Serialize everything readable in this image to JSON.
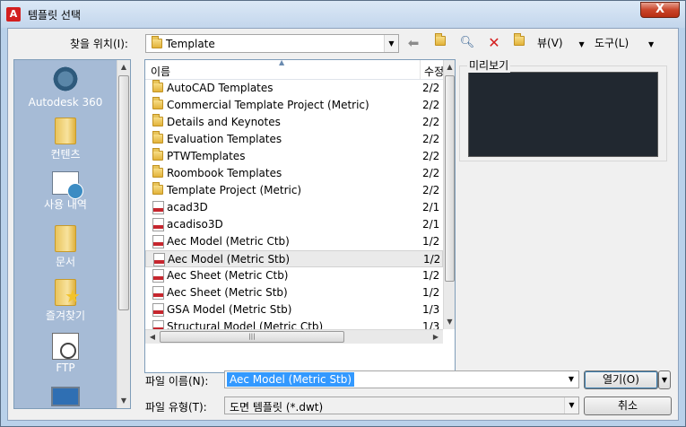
{
  "window": {
    "title": "템플릿 선택",
    "close_label": "X"
  },
  "toolbar": {
    "look_in_label": "찾을 위치(I):",
    "look_in_value": "Template",
    "views_label": "뷰(V)",
    "tools_label": "도구(L)"
  },
  "places": [
    {
      "label": "Autodesk 360",
      "icon": "autodesk-360-icon"
    },
    {
      "label": "컨텐츠",
      "icon": "folder-icon"
    },
    {
      "label": "사용 내역",
      "icon": "history-icon"
    },
    {
      "label": "문서",
      "icon": "folder-icon"
    },
    {
      "label": "즐겨찾기",
      "icon": "favorites-icon"
    },
    {
      "label": "FTP",
      "icon": "ftp-icon"
    }
  ],
  "file_list": {
    "columns": [
      "이름",
      "수정"
    ],
    "rows": [
      {
        "name": "AutoCAD Templates",
        "date": "2/2",
        "type": "folder"
      },
      {
        "name": "Commercial Template Project (Metric)",
        "date": "2/2",
        "type": "folder"
      },
      {
        "name": "Details and Keynotes",
        "date": "2/2",
        "type": "folder"
      },
      {
        "name": "Evaluation Templates",
        "date": "2/2",
        "type": "folder"
      },
      {
        "name": "PTWTemplates",
        "date": "2/2",
        "type": "folder"
      },
      {
        "name": "Roombook Templates",
        "date": "2/2",
        "type": "folder"
      },
      {
        "name": "Template Project (Metric)",
        "date": "2/2",
        "type": "folder"
      },
      {
        "name": "acad3D",
        "date": "2/1",
        "type": "dwt"
      },
      {
        "name": "acadiso3D",
        "date": "2/1",
        "type": "dwt"
      },
      {
        "name": "Aec Model (Metric Ctb)",
        "date": "1/2",
        "type": "dwt"
      },
      {
        "name": "Aec Model (Metric Stb)",
        "date": "1/2",
        "type": "dwt"
      },
      {
        "name": "Aec Sheet (Metric Ctb)",
        "date": "1/2",
        "type": "dwt"
      },
      {
        "name": "Aec Sheet (Metric Stb)",
        "date": "1/2",
        "type": "dwt"
      },
      {
        "name": "GSA Model (Metric Stb)",
        "date": "1/3",
        "type": "dwt"
      },
      {
        "name": "Structural Model (Metric Ctb)",
        "date": "1/3",
        "type": "dwt"
      }
    ],
    "selected_index": 10
  },
  "preview": {
    "label": "미리보기",
    "background_color": "#212830"
  },
  "bottom": {
    "file_name_label": "파일 이름(N):",
    "file_name_value": "Aec Model (Metric Stb)",
    "file_type_label": "파일 유형(T):",
    "file_type_value": "도면 템플릿 (*.dwt)",
    "open_label": "열기(O)",
    "cancel_label": "취소"
  },
  "colors": {
    "selection": "#3399ff",
    "title_accent": "#d31f1f"
  }
}
